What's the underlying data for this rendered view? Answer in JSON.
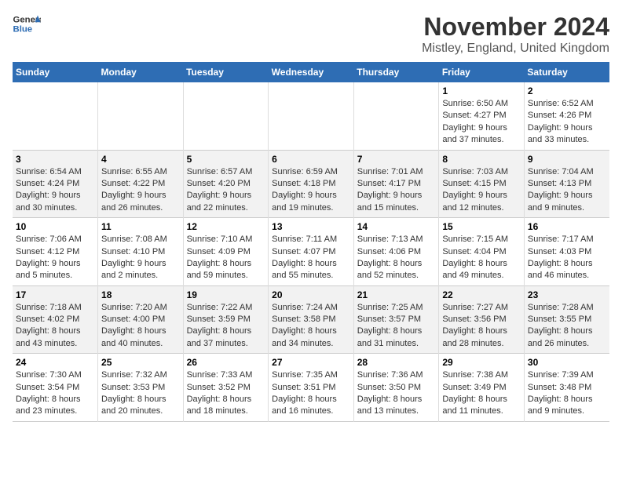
{
  "logo": {
    "general": "General",
    "blue": "Blue"
  },
  "header": {
    "month": "November 2024",
    "location": "Mistley, England, United Kingdom"
  },
  "weekdays": [
    "Sunday",
    "Monday",
    "Tuesday",
    "Wednesday",
    "Thursday",
    "Friday",
    "Saturday"
  ],
  "weeks": [
    [
      {
        "day": "",
        "info": ""
      },
      {
        "day": "",
        "info": ""
      },
      {
        "day": "",
        "info": ""
      },
      {
        "day": "",
        "info": ""
      },
      {
        "day": "",
        "info": ""
      },
      {
        "day": "1",
        "info": "Sunrise: 6:50 AM\nSunset: 4:27 PM\nDaylight: 9 hours and 37 minutes."
      },
      {
        "day": "2",
        "info": "Sunrise: 6:52 AM\nSunset: 4:26 PM\nDaylight: 9 hours and 33 minutes."
      }
    ],
    [
      {
        "day": "3",
        "info": "Sunrise: 6:54 AM\nSunset: 4:24 PM\nDaylight: 9 hours and 30 minutes."
      },
      {
        "day": "4",
        "info": "Sunrise: 6:55 AM\nSunset: 4:22 PM\nDaylight: 9 hours and 26 minutes."
      },
      {
        "day": "5",
        "info": "Sunrise: 6:57 AM\nSunset: 4:20 PM\nDaylight: 9 hours and 22 minutes."
      },
      {
        "day": "6",
        "info": "Sunrise: 6:59 AM\nSunset: 4:18 PM\nDaylight: 9 hours and 19 minutes."
      },
      {
        "day": "7",
        "info": "Sunrise: 7:01 AM\nSunset: 4:17 PM\nDaylight: 9 hours and 15 minutes."
      },
      {
        "day": "8",
        "info": "Sunrise: 7:03 AM\nSunset: 4:15 PM\nDaylight: 9 hours and 12 minutes."
      },
      {
        "day": "9",
        "info": "Sunrise: 7:04 AM\nSunset: 4:13 PM\nDaylight: 9 hours and 9 minutes."
      }
    ],
    [
      {
        "day": "10",
        "info": "Sunrise: 7:06 AM\nSunset: 4:12 PM\nDaylight: 9 hours and 5 minutes."
      },
      {
        "day": "11",
        "info": "Sunrise: 7:08 AM\nSunset: 4:10 PM\nDaylight: 9 hours and 2 minutes."
      },
      {
        "day": "12",
        "info": "Sunrise: 7:10 AM\nSunset: 4:09 PM\nDaylight: 8 hours and 59 minutes."
      },
      {
        "day": "13",
        "info": "Sunrise: 7:11 AM\nSunset: 4:07 PM\nDaylight: 8 hours and 55 minutes."
      },
      {
        "day": "14",
        "info": "Sunrise: 7:13 AM\nSunset: 4:06 PM\nDaylight: 8 hours and 52 minutes."
      },
      {
        "day": "15",
        "info": "Sunrise: 7:15 AM\nSunset: 4:04 PM\nDaylight: 8 hours and 49 minutes."
      },
      {
        "day": "16",
        "info": "Sunrise: 7:17 AM\nSunset: 4:03 PM\nDaylight: 8 hours and 46 minutes."
      }
    ],
    [
      {
        "day": "17",
        "info": "Sunrise: 7:18 AM\nSunset: 4:02 PM\nDaylight: 8 hours and 43 minutes."
      },
      {
        "day": "18",
        "info": "Sunrise: 7:20 AM\nSunset: 4:00 PM\nDaylight: 8 hours and 40 minutes."
      },
      {
        "day": "19",
        "info": "Sunrise: 7:22 AM\nSunset: 3:59 PM\nDaylight: 8 hours and 37 minutes."
      },
      {
        "day": "20",
        "info": "Sunrise: 7:24 AM\nSunset: 3:58 PM\nDaylight: 8 hours and 34 minutes."
      },
      {
        "day": "21",
        "info": "Sunrise: 7:25 AM\nSunset: 3:57 PM\nDaylight: 8 hours and 31 minutes."
      },
      {
        "day": "22",
        "info": "Sunrise: 7:27 AM\nSunset: 3:56 PM\nDaylight: 8 hours and 28 minutes."
      },
      {
        "day": "23",
        "info": "Sunrise: 7:28 AM\nSunset: 3:55 PM\nDaylight: 8 hours and 26 minutes."
      }
    ],
    [
      {
        "day": "24",
        "info": "Sunrise: 7:30 AM\nSunset: 3:54 PM\nDaylight: 8 hours and 23 minutes."
      },
      {
        "day": "25",
        "info": "Sunrise: 7:32 AM\nSunset: 3:53 PM\nDaylight: 8 hours and 20 minutes."
      },
      {
        "day": "26",
        "info": "Sunrise: 7:33 AM\nSunset: 3:52 PM\nDaylight: 8 hours and 18 minutes."
      },
      {
        "day": "27",
        "info": "Sunrise: 7:35 AM\nSunset: 3:51 PM\nDaylight: 8 hours and 16 minutes."
      },
      {
        "day": "28",
        "info": "Sunrise: 7:36 AM\nSunset: 3:50 PM\nDaylight: 8 hours and 13 minutes."
      },
      {
        "day": "29",
        "info": "Sunrise: 7:38 AM\nSunset: 3:49 PM\nDaylight: 8 hours and 11 minutes."
      },
      {
        "day": "30",
        "info": "Sunrise: 7:39 AM\nSunset: 3:48 PM\nDaylight: 8 hours and 9 minutes."
      }
    ]
  ]
}
